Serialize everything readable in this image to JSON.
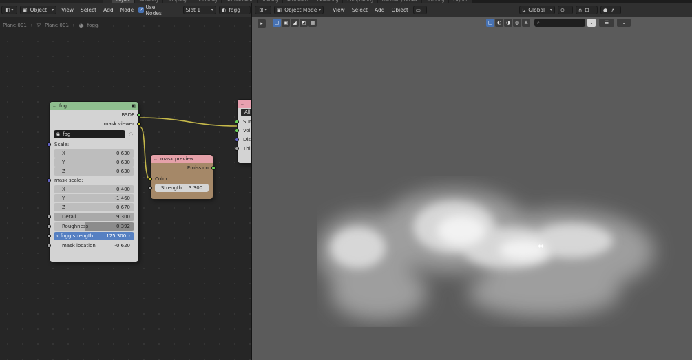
{
  "workspace_tabs": [
    "",
    "Layout",
    "Modeling",
    "Sculpting",
    "UV Editing",
    "Texture Paint",
    "Shading",
    "Animation",
    "Rendering",
    "Compositing",
    "Geometry Nodes",
    "Scripting",
    "Layout"
  ],
  "node_editor": {
    "header": {
      "mode": "Object",
      "menus": [
        "View",
        "Select",
        "Add",
        "Node"
      ],
      "use_nodes_label": "Use Nodes",
      "slot": "Slot 1",
      "material": "fogg"
    },
    "breadcrumb": [
      "Plane.001",
      "Plane.001",
      "fogg"
    ],
    "fog_node": {
      "title": "fog",
      "outputs": [
        "BSDF",
        "mask viewer"
      ],
      "datablock": "fog",
      "scale_label": "Scale:",
      "scale": [
        {
          "axis": "X",
          "value": "0.630"
        },
        {
          "axis": "Y",
          "value": "0.630"
        },
        {
          "axis": "Z",
          "value": "0.630"
        }
      ],
      "mask_scale_label": "mask scale:",
      "mask_scale": [
        {
          "axis": "X",
          "value": "0.400"
        },
        {
          "axis": "Y",
          "value": "-1.460"
        },
        {
          "axis": "Z",
          "value": "0.670"
        }
      ],
      "detail": {
        "label": "Detail",
        "value": "9.300"
      },
      "roughness": {
        "label": "Roughness",
        "value": "0.392"
      },
      "fogg_strength": {
        "label": "fogg strength",
        "value": "125.300"
      },
      "mask_location": {
        "label": "mask location",
        "value": "-0.620"
      }
    },
    "mask_preview_node": {
      "title": "mask preview",
      "output": "Emission",
      "color_label": "Color",
      "strength": {
        "label": "Strength",
        "value": "3.300"
      }
    },
    "output_node": {
      "title": "Material Output",
      "target": "All",
      "inputs": [
        "Surface",
        "Volume",
        "Displacement",
        "Thickness"
      ]
    }
  },
  "viewport": {
    "header": {
      "mode": "Object Mode",
      "menus": [
        "View",
        "Select",
        "Add",
        "Object"
      ],
      "transform_orientation": "Global"
    },
    "search_placeholder": ""
  },
  "colors": {
    "group_header": "#8fbf8f",
    "output_header": "#e8a0b0",
    "shader_header": "#e5a1a9",
    "link": "#c5b84a",
    "socket_shader": "#6bd15a",
    "socket_color": "#c7c729",
    "socket_value": "#a1a1a1",
    "socket_vector": "#6363c7",
    "active_field": "#5680c2"
  }
}
